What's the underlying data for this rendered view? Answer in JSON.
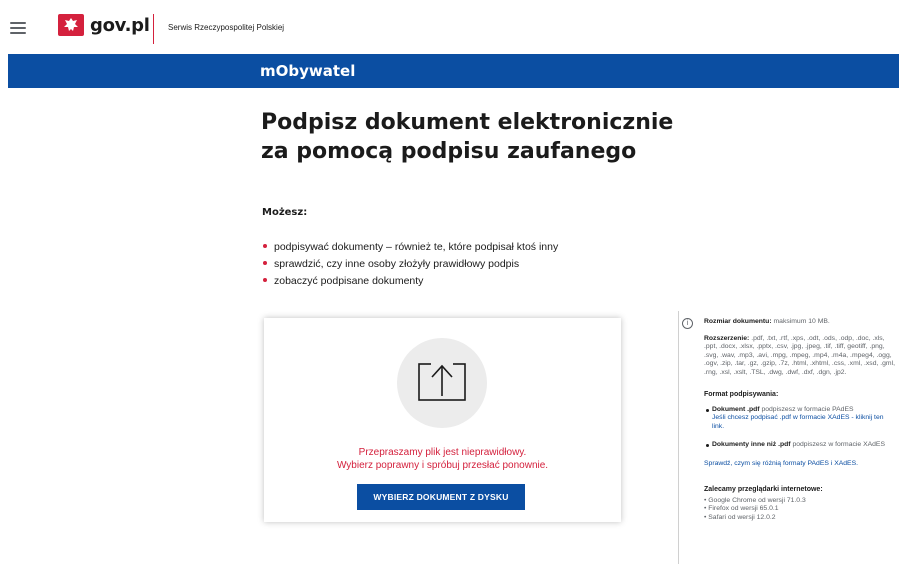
{
  "header": {
    "logo_text": "gov.pl",
    "service_name": "Serwis Rzeczypospolitej Polskiej"
  },
  "banner": {
    "app_name": "mObywatel"
  },
  "page": {
    "title_line1": "Podpisz dokument elektronicznie",
    "title_line2": "za pomocą podpisu zaufanego",
    "can_label": "Możesz:",
    "bullets": [
      "podpisywać dokumenty – również te, które podpisał ktoś inny",
      "sprawdzić, czy inne osoby złożyły prawidłowy podpis",
      "zobaczyć podpisane dokumenty"
    ]
  },
  "upload": {
    "error_line1": "Przepraszamy plik jest nieprawidłowy.",
    "error_line2": "Wybierz poprawny i spróbuj przesłać ponownie.",
    "button_label": "WYBIERZ DOKUMENT Z DYSKU"
  },
  "sidebar": {
    "size_label": "Rozmiar dokumentu:",
    "size_value": "maksimum 10 MB.",
    "ext_label": "Rozszerzenie:",
    "ext_value": ".pdf, .txt, .rtf, .xps, .odt, .ods, .odp, .doc, .xls, .ppt, .docx, .xlsx, .pptx, .csv, .jpg, .jpeg, .tif, .tiff, geotiff, .png, .svg, .wav, .mp3, .avi, .mpg, .mpeg, .mp4, .m4a, .mpeg4, .ogg, .ogv, .zip, .tar, .gz, .gzip, .7z, .html, .xhtml, .css, .xml, .xsd, .gml, .rng, .xsl, .xslt, .TSL, .dwg, .dwf, .dxf, .dgn, .jp2.",
    "format_heading": "Format podpisywania:",
    "format_pdf_bold": "Dokument .pdf",
    "format_pdf_text": "podpiszesz w formacie PAdES",
    "format_pdf_link": "Jeśli chcesz podpisać .pdf w formacie XAdES - kliknij ten link.",
    "format_other_bold": "Dokumenty inne niż .pdf",
    "format_other_text": "podpiszesz w formacie XAdES",
    "compare_link": "Sprawdź, czym się różnią formaty PAdES i XAdES.",
    "browsers_heading": "Zalecamy przeglądarki internetowe:",
    "browsers": [
      "• Google Chrome od wersji 71.0.3",
      "• Firefox od wersji 65.0.1",
      "• Safari od wersji 12.0.2"
    ]
  },
  "colors": {
    "primary_blue": "#0b4ea2",
    "accent_red": "#d4213d"
  }
}
